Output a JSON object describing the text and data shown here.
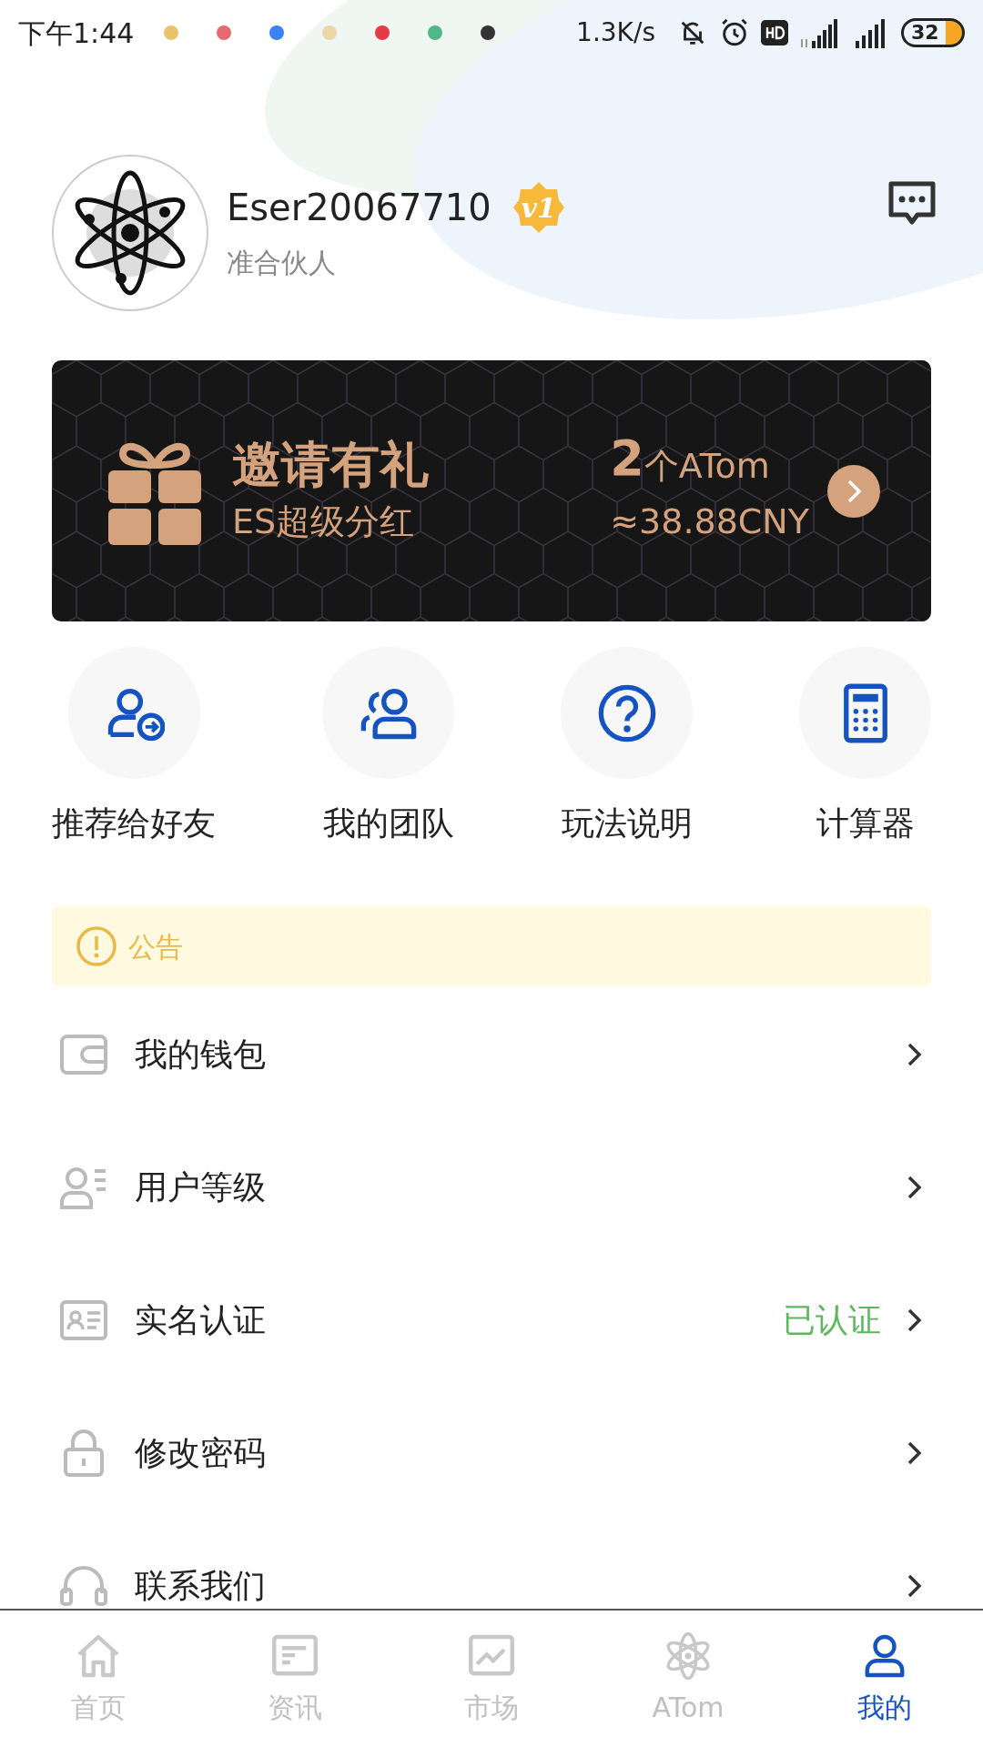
{
  "status_bar": {
    "time": "下午1:44",
    "speed": "1.3K/s",
    "battery": "32"
  },
  "profile": {
    "username": "Eser20067710",
    "level_badge": "v1",
    "role": "准合伙人"
  },
  "banner": {
    "title": "邀请有礼",
    "subtitle": "ES超级分红",
    "amount": "2",
    "unit": "个ATom",
    "value": "≈38.88CNY"
  },
  "shortcuts": [
    {
      "kind": "invite",
      "label": "推荐给好友"
    },
    {
      "kind": "team",
      "label": "我的团队"
    },
    {
      "kind": "help",
      "label": "玩法说明"
    },
    {
      "kind": "calculator",
      "label": "计算器"
    }
  ],
  "notice": {
    "label": "公告"
  },
  "menu": [
    {
      "kind": "wallet",
      "label": "我的钱包"
    },
    {
      "kind": "level",
      "label": "用户等级"
    },
    {
      "kind": "idcard",
      "label": "实名认证",
      "status": "已认证"
    },
    {
      "kind": "lock",
      "label": "修改密码"
    },
    {
      "kind": "contact",
      "label": "联系我们"
    }
  ],
  "tabs": [
    {
      "kind": "home",
      "label": "首页",
      "selected": false
    },
    {
      "kind": "news",
      "label": "资讯",
      "selected": false
    },
    {
      "kind": "market",
      "label": "市场",
      "selected": false
    },
    {
      "kind": "atom",
      "label": "ATom",
      "selected": false
    },
    {
      "kind": "me",
      "label": "我的",
      "selected": true
    }
  ]
}
